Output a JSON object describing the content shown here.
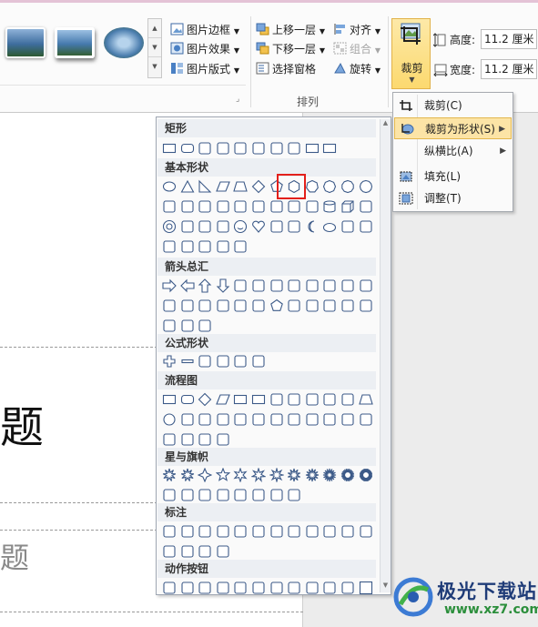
{
  "ribbon": {
    "picture_styles": {
      "border_label": "图片边框",
      "effects_label": "图片效果",
      "layout_label": "图片版式"
    },
    "arrange": {
      "bring_forward_label": "上移一层",
      "send_backward_label": "下移一层",
      "selection_pane_label": "选择窗格",
      "align_label": "对齐",
      "group_label": "组合",
      "rotate_label": "旋转",
      "group_name": "排列"
    },
    "crop_label": "裁剪",
    "size": {
      "height_label": "高度:",
      "height_value": "11.2 厘米",
      "width_label": "宽度:",
      "width_value": "11.2 厘米"
    }
  },
  "slide": {
    "title_fragment": "题",
    "subtitle_fragment": "题"
  },
  "shapes_panel": {
    "categories": [
      "矩形",
      "基本形状",
      "箭头总汇",
      "公式形状",
      "流程图",
      "星与旗帜",
      "标注",
      "动作按钮"
    ],
    "highlighted_shape": "hexagon"
  },
  "crop_menu": {
    "items": [
      {
        "label": "裁剪(C)",
        "has_submenu": false,
        "highlighted": false
      },
      {
        "label": "裁剪为形状(S)",
        "has_submenu": true,
        "highlighted": true
      },
      {
        "label": "纵横比(A)",
        "has_submenu": true,
        "highlighted": false
      },
      {
        "label": "填充(L)",
        "has_submenu": false,
        "highlighted": false
      },
      {
        "label": "调整(T)",
        "has_submenu": false,
        "highlighted": false
      }
    ]
  },
  "watermark": {
    "name": "极光下载站",
    "url": "www.xz7.com"
  },
  "colors": {
    "menu_highlight": "#fce4a6",
    "shape_highlight_border": "#e3201b",
    "shape_stroke": "#3c5a88"
  }
}
